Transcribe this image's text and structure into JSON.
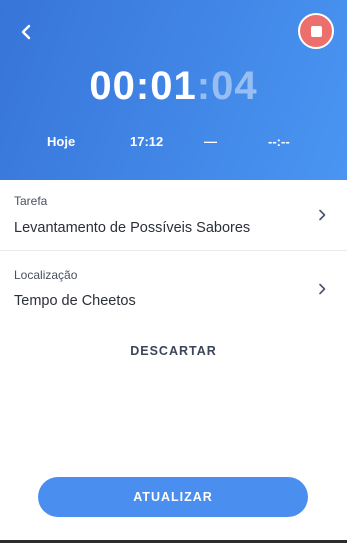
{
  "header": {
    "back_icon": "chevron-left-icon",
    "stop_icon": "stop-icon",
    "timer": {
      "hours": "00",
      "sep1": ":",
      "minutes": "01",
      "sep2": ":",
      "seconds": "04"
    },
    "date_label": "Hoje",
    "start_time": "17:12",
    "separator": "—",
    "end_time": "--:--"
  },
  "task": {
    "label": "Tarefa",
    "value": "Levantamento de Possíveis Sabores",
    "chevron_icon": "chevron-right-icon"
  },
  "location": {
    "label": "Localização",
    "value": "Tempo de Cheetos",
    "chevron_icon": "chevron-right-icon"
  },
  "actions": {
    "discard_label": "DESCARTAR",
    "update_label": "ATUALIZAR"
  },
  "colors": {
    "header_start": "#3775d8",
    "header_end": "#4a95f2",
    "stop": "#ec6f6e",
    "button": "#4a8ef0"
  }
}
